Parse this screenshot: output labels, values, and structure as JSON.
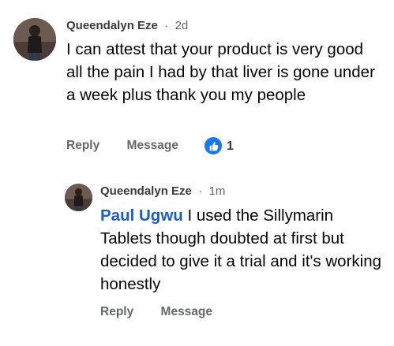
{
  "comment": {
    "author": "Queendalyn Eze",
    "separator": "·",
    "time": "2d",
    "text": "I can attest that your product is very good all the pain I had by that liver is gone under a week plus thank you my people",
    "reply_label": "Reply",
    "message_label": "Message",
    "like_count": "1",
    "like_icon": "thumbs-up-icon",
    "like_color": "#1877f2"
  },
  "reply": {
    "author": "Queendalyn Eze",
    "separator": "·",
    "time": "1m",
    "mention": "Paul Ugwu",
    "text": " I used the Sillymarin Tablets though doubted at first but decided to give it a trial and it's working honestly",
    "reply_label": "Reply",
    "message_label": "Message",
    "mention_color": "#1a5fc7"
  }
}
